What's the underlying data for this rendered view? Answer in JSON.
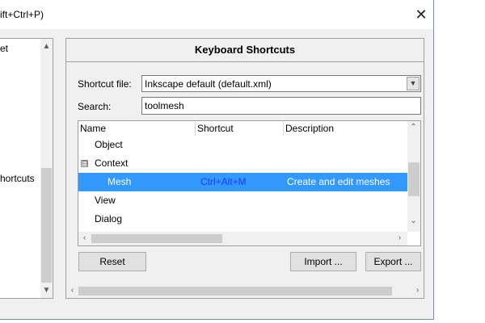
{
  "window": {
    "title_fragment": "ift+Ctrl+P)",
    "close_glyph": "✕"
  },
  "left_tree": {
    "items": [
      {
        "label": "et"
      },
      {
        "label": "hortcuts"
      }
    ]
  },
  "panel": {
    "heading": "Keyboard Shortcuts",
    "shortcut_file_label": "Shortcut file:",
    "shortcut_file_value": "Inkscape default (default.xml)",
    "search_label": "Search:",
    "search_value": "toolmesh"
  },
  "table": {
    "columns": [
      "Name",
      "Shortcut",
      "Description"
    ],
    "rows": [
      {
        "name": "Object",
        "shortcut": "",
        "description": "",
        "indent": 1,
        "expander": "",
        "selected": false
      },
      {
        "name": "Context",
        "shortcut": "",
        "description": "",
        "indent": 1,
        "expander": "⊟",
        "selected": false
      },
      {
        "name": "Mesh",
        "shortcut": "Ctrl+Alt+M",
        "description": "Create and edit meshes",
        "indent": 2,
        "expander": "",
        "selected": true
      },
      {
        "name": "View",
        "shortcut": "",
        "description": "",
        "indent": 1,
        "expander": "",
        "selected": false
      },
      {
        "name": "Dialog",
        "shortcut": "",
        "description": "",
        "indent": 1,
        "expander": "",
        "selected": false
      }
    ]
  },
  "buttons": {
    "reset": "Reset",
    "import": "Import ...",
    "export": "Export ..."
  },
  "colors": {
    "selection": "#3399ff",
    "shortcut_text": "#1a3cff"
  }
}
